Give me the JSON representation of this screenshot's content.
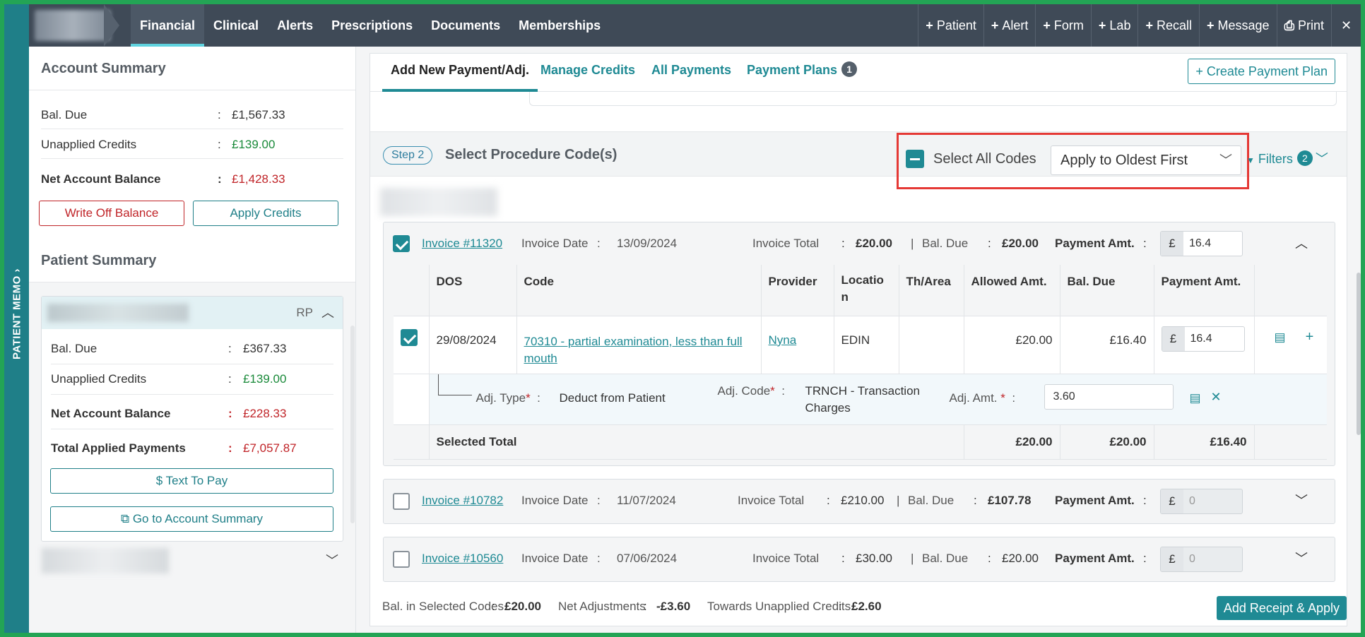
{
  "sidebar": {
    "label": "PATIENT MEMO"
  },
  "topnav": {
    "tabs": [
      "Financial",
      "Clinical",
      "Alerts",
      "Prescriptions",
      "Documents",
      "Memberships"
    ],
    "actions": [
      "Patient",
      "Alert",
      "Form",
      "Lab",
      "Recall",
      "Message",
      "Print"
    ],
    "close": "✕"
  },
  "account_summary": {
    "title": "Account Summary",
    "bal_due_label": "Bal. Due",
    "bal_due": "£1,567.33",
    "unapplied_label": "Unapplied Credits",
    "unapplied": "£139.00",
    "net_label": "Net Account Balance",
    "net": "£1,428.33",
    "write_off": "Write Off Balance",
    "apply_credits": "Apply Credits"
  },
  "patient_summary": {
    "title": "Patient Summary",
    "initials": "RP",
    "bal_due_label": "Bal. Due",
    "bal_due": "£367.33",
    "unapplied_label": "Unapplied Credits",
    "unapplied": "£139.00",
    "net_label": "Net Account Balance",
    "net": "£228.33",
    "applied_label": "Total Applied Payments",
    "applied": "£7,057.87",
    "text_to_pay": "Text To Pay",
    "go_account": "Go to Account Summary"
  },
  "tabs": {
    "add": "Add New Payment/Adj.",
    "credits": "Manage Credits",
    "payments": "All Payments",
    "plans": "Payment Plans",
    "plans_count": "1",
    "create": "Create Payment Plan"
  },
  "step": {
    "pill": "Step 2",
    "title": "Select Procedure Code(s)",
    "select_all": "Select All Codes",
    "apply_order": "Apply to Oldest First",
    "filters": "Filters",
    "filters_count": "2"
  },
  "invoices": [
    {
      "number": "Invoice #11320",
      "date_label": "Invoice Date",
      "date": "13/09/2024",
      "total_label": "Invoice Total",
      "total": "£20.00",
      "bal_label": "Bal. Due",
      "bal": "£20.00",
      "pay_label": "Payment Amt.",
      "currency": "£",
      "pay": "16.4",
      "checked": true
    },
    {
      "number": "Invoice #10782",
      "date_label": "Invoice Date",
      "date": "11/07/2024",
      "total_label": "Invoice Total",
      "total": "£210.00",
      "bal_label": "Bal. Due",
      "bal": "£107.78",
      "pay_label": "Payment Amt.",
      "currency": "£",
      "pay": "0",
      "checked": false
    },
    {
      "number": "Invoice #10560",
      "date_label": "Invoice Date",
      "date": "07/06/2024",
      "total_label": "Invoice Total",
      "total": "£30.00",
      "bal_label": "Bal. Due",
      "bal": "£20.00",
      "pay_label": "Payment Amt.",
      "currency": "£",
      "pay": "0",
      "checked": false
    }
  ],
  "lines": {
    "headers": [
      "DOS",
      "Code",
      "Provider",
      "Locatio\nn",
      "Th/Area",
      "Allowed Amt.",
      "Bal. Due",
      "Payment Amt."
    ],
    "row": {
      "dos": "29/08/2024",
      "code": "70310 - partial examination, less than full mouth",
      "provider": "Nyna",
      "location": "EDIN",
      "th_area": "",
      "allowed": "£20.00",
      "bal": "£16.40",
      "currency": "£",
      "pay": "16.4"
    },
    "adj": {
      "type_label": "Adj. Type",
      "type": "Deduct from Patient",
      "code_label": "Adj. Code",
      "code": "TRNCH - Transaction Charges",
      "amt_label": "Adj. Amt.",
      "amt": "3.60"
    },
    "total": {
      "label": "Selected Total",
      "allowed": "£20.00",
      "bal": "£20.00",
      "pay": "£16.40"
    }
  },
  "footer": {
    "bal_label": "Bal. in Selected Codes",
    "bal": "£20.00",
    "net_label": "Net Adjustments",
    "net": "-£3.60",
    "towards_label": "Towards Unapplied Credits",
    "towards": "£2.60",
    "apply_btn": "Add Receipt & Apply"
  },
  "colors": {
    "teal": "#1f8a94",
    "sidebar": "#1f7f88",
    "topbar": "#3f4a57",
    "red": "#c02428",
    "green": "#1a8a3a",
    "highlight": "#e53935"
  }
}
